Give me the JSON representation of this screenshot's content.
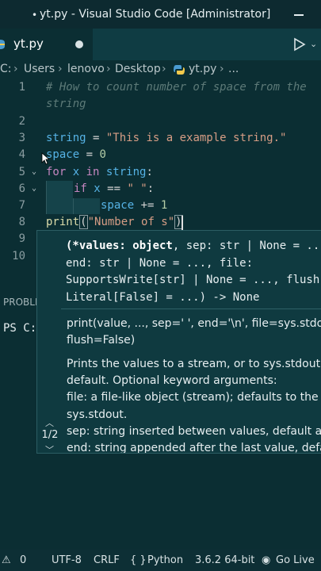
{
  "window": {
    "title": "yt.py - Visual Studio Code [Administrator]"
  },
  "tab": {
    "label": "yt.py"
  },
  "breadcrumb": {
    "drive": "C:",
    "users": "Users",
    "user": "lenovo",
    "desktop": "Desktop",
    "file": "yt.py",
    "more": "..."
  },
  "editor": {
    "line_numbers": [
      "1",
      "2",
      "3",
      "4",
      "5",
      "6",
      "7",
      "8",
      "9",
      "10"
    ],
    "comment_line1": "# How to count number of space from the",
    "comment_line2": "string",
    "l3_var": "string",
    "l3_op": " = ",
    "l3_str": "\"This is a example string.\"",
    "l4_var": "space",
    "l4_op": " = ",
    "l4_num": "0",
    "l5_kw1": "for",
    "l5_var1": " x ",
    "l5_kw2": "in",
    "l5_var2": " string",
    "l5_colon": ":",
    "l6_kw": "if",
    "l6_var": " x ",
    "l6_op": "== ",
    "l6_str": "\" \"",
    "l6_colon": ":",
    "l7_var": "space",
    "l7_op": " += ",
    "l7_num": "1",
    "l8_fn": "print",
    "l8_paren": "(",
    "l8_str": "\"Number of s\"",
    "l8_close": ")"
  },
  "hover": {
    "sig1_bold": "(*values: object",
    "sig1_rest": ", sep: str | None = ...",
    "sig2": "end: str | None = ..., file:",
    "sig3": "SupportsWrite[str] | None = ..., flush:",
    "sig4": "Literal[False] = ...) -> None",
    "doc1": "print(value, ..., sep=' ', end='\\n', file=sys.stdout,",
    "doc2": "flush=False)",
    "doc3": "Prints the values to a stream, or to sys.stdout by",
    "doc4": "default. Optional keyword arguments:",
    "doc5": "file: a file-like object (stream); defaults to the current",
    "doc6": "sys.stdout.",
    "doc7": "sep: string inserted between values, default a space.",
    "doc8": "end: string appended after the last value, default a newline.",
    "pager": "1/2"
  },
  "panel": {
    "tab_label": "PROBLE",
    "terminal_prompt": "PS C:"
  },
  "status": {
    "errors": "0",
    "encoding": "UTF-8",
    "eol": "CRLF",
    "language": "Python",
    "interpreter": "3.6.2 64-bit",
    "live": "Go Live"
  },
  "colors": {
    "background": "#0b2e33",
    "tab_bar": "#0f3c43",
    "hover_bg": "#0f3a40",
    "keyword": "#c586c0",
    "variable": "#56b3e6",
    "string": "#d69d85",
    "number": "#b5cea8",
    "function": "#dcdcaa"
  }
}
